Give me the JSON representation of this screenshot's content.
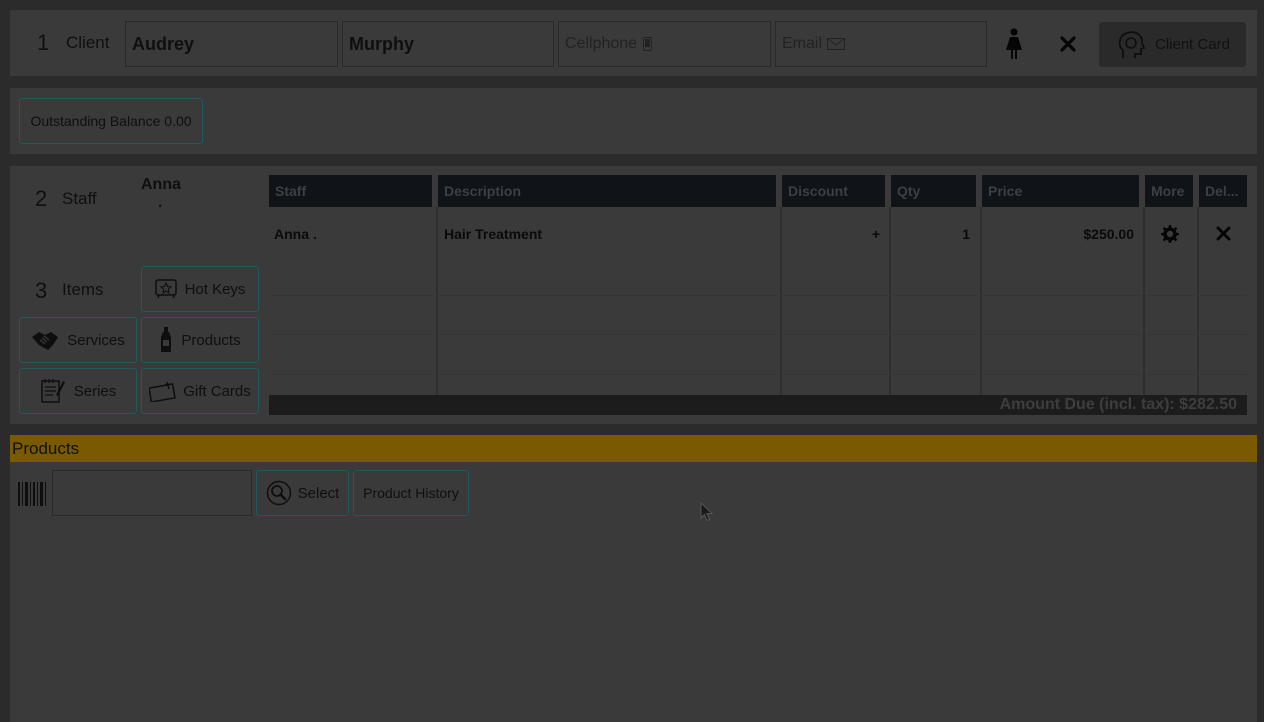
{
  "client": {
    "section_number": "1",
    "section_label": "Client",
    "first_name": "Audrey",
    "last_name": "Murphy",
    "cellphone_placeholder": "Cellphone",
    "email_placeholder": "Email",
    "client_card_label": "Client Card",
    "outstanding_balance": "Outstanding Balance 0.00"
  },
  "staff": {
    "section_number": "2",
    "section_label": "Staff",
    "selected_name": "Anna",
    "selected_sub": "."
  },
  "items": {
    "section_number": "3",
    "section_label": "Items",
    "buttons": {
      "hot_keys": "Hot Keys",
      "services": "Services",
      "products": "Products",
      "series": "Series",
      "gift_cards": "Gift Cards"
    }
  },
  "table": {
    "headers": {
      "staff": "Staff",
      "description": "Description",
      "discount": "Discount",
      "qty": "Qty",
      "price": "Price",
      "more": "More",
      "delete": "Del..."
    },
    "rows": [
      {
        "staff": "Anna .",
        "description": "Hair Treatment",
        "discount": "+",
        "qty": "1",
        "price": "$250.00"
      }
    ],
    "amount_due": "Amount Due (incl. tax): $282.50"
  },
  "products_panel": {
    "title": "Products",
    "select_label": "Select",
    "history_label": "Product History",
    "barcode_value": ""
  },
  "colors": {
    "overlay_background": "#2b2b2b",
    "panel": "#3a3a3a",
    "header_dark": "#101418",
    "products_bar": "#7a5a00",
    "button_border": "#1e5a5e"
  },
  "icons": {
    "gender": "female-figure-icon",
    "close": "close-x-icon",
    "client_card": "client-card-head-icon",
    "hot_keys": "hot-keys-icon",
    "services": "handshake-icon",
    "products": "bottle-icon",
    "series": "notepad-icon",
    "gift_cards": "gift-card-icon",
    "settings": "gear-icon",
    "delete": "delete-x-icon",
    "barcode": "barcode-icon",
    "search": "magnifier-icon",
    "cellphone": "phone-icon",
    "email": "envelope-icon",
    "cursor": "mouse-pointer-icon"
  }
}
